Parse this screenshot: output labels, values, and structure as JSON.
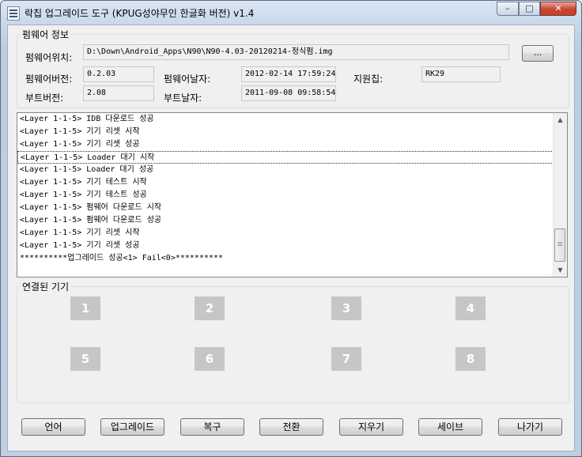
{
  "window": {
    "title": "락칩 업그레이드 도구 (KPUG성야무인 한글화 버전) v1.4",
    "controls": {
      "minimize": "–",
      "maximize": "□",
      "close": "✕"
    }
  },
  "firmware_info": {
    "group_title": "펌웨어 정보",
    "location_label": "펌웨어위치:",
    "location_value": "D:\\Down\\Android_Apps\\N90\\N90-4.03-20120214-정식펌.img",
    "browse_label": "...",
    "version_label": "펌웨어버전:",
    "version_value": "0.2.03",
    "date_label": "펌웨어날자:",
    "date_value": "2012-02-14 17:59:24",
    "chip_label": "지원칩:",
    "chip_value": "RK29",
    "boot_version_label": "부트버전:",
    "boot_version_value": "2.08",
    "boot_date_label": "부트날자:",
    "boot_date_value": "2011-09-08 09:58:54"
  },
  "log": {
    "lines": [
      "<Layer 1-1-5> IDB 다운로드 성공",
      "<Layer 1-1-5> 기기 리셋 시작",
      "<Layer 1-1-5> 기기 리셋 성공",
      "<Layer 1-1-5> Loader 대기 시작",
      "<Layer 1-1-5> Loader 대기 성공",
      "<Layer 1-1-5> 기기 테스트 시작",
      "<Layer 1-1-5> 기기 테스트 성공",
      "<Layer 1-1-5> 펌웨어 다운로드 시작",
      "<Layer 1-1-5> 펌웨어 다운로드 성공",
      "<Layer 1-1-5> 기기 리셋 시작",
      "<Layer 1-1-5> 기기 리셋 성공",
      "**********업그레이드 성공<1> Fail<0>**********"
    ],
    "selected_index": 3,
    "scroll_up": "▲",
    "scroll_down": "▼"
  },
  "connected_devices": {
    "group_title": "연결된 기기",
    "slots": [
      "1",
      "2",
      "3",
      "4",
      "5",
      "6",
      "7",
      "8"
    ]
  },
  "buttons": {
    "language": "언어",
    "upgrade": "업그레이드",
    "restore": "복구",
    "switch": "전환",
    "erase": "지우기",
    "save": "세이브",
    "exit": "나가기"
  }
}
